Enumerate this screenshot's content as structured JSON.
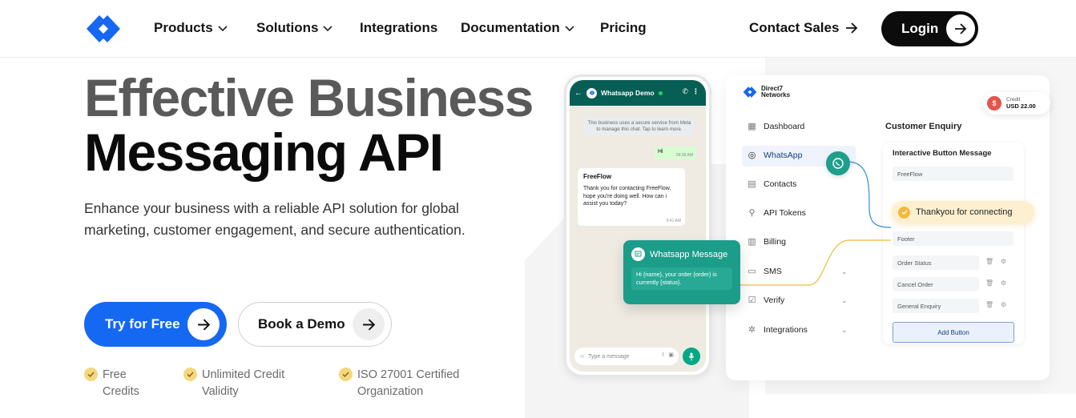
{
  "nav": {
    "products": "Products",
    "solutions": "Solutions",
    "integrations": "Integrations",
    "documentation": "Documentation",
    "pricing": "Pricing",
    "contact_sales": "Contact Sales",
    "login": "Login"
  },
  "hero": {
    "title_line1": "Effective Business",
    "title_line2": "Messaging API",
    "subtitle": "Enhance your business with a reliable API solution for global marketing, customer engagement, and secure authentication.",
    "cta_primary": "Try for Free",
    "cta_secondary": "Book a Demo",
    "features": [
      {
        "line1": "Free",
        "line2": "Credits"
      },
      {
        "line1": "Unlimited Credit",
        "line2": "Validity"
      },
      {
        "line1": "ISO 27001 Certified",
        "line2": "Organization"
      }
    ]
  },
  "phone": {
    "chat_title": "Whatsapp Demo",
    "notice": "This business uses a secure service from Meta to manage this chat. Tap to learn more.",
    "outgoing": "Hi",
    "outgoing_time": "09:38 AM",
    "incoming_name": "FreeFlow",
    "incoming_text": "Thank you for contacting FreeFlow, hope you're doing well. How can i assist you today?",
    "incoming_time": "9:41 AM",
    "input_placeholder": "Type a message"
  },
  "wa_card": {
    "title": "Whatsapp Message",
    "body": "Hi {name}, your order {order} is currently {status}."
  },
  "dashboard": {
    "brand": "Direct7 Networks",
    "brand_line1": "Direct7",
    "brand_line2": "Networks",
    "credit_label": "Credit",
    "credit_value": "USD 22.00",
    "menu": [
      {
        "label": "Dashboard",
        "icon": "grid-icon"
      },
      {
        "label": "WhatsApp",
        "icon": "whatsapp-icon"
      },
      {
        "label": "Contacts",
        "icon": "contacts-icon"
      },
      {
        "label": "API Tokens",
        "icon": "search-icon"
      },
      {
        "label": "Billing",
        "icon": "billing-icon"
      },
      {
        "label": "SMS",
        "icon": "sms-icon"
      },
      {
        "label": "Verify",
        "icon": "verify-icon"
      },
      {
        "label": "Integrations",
        "icon": "integrations-icon"
      }
    ],
    "section_title": "Customer Enquiry",
    "panel_title": "Interactive Button Message",
    "field_name": "FreeFlow",
    "toast": "Thankyou for connecting",
    "footer_label": "Footer",
    "buttons": [
      "Order Status",
      "Cancel Order",
      "General Enquiry"
    ],
    "add_button": "Add Button"
  },
  "colors": {
    "brand_blue": "#1568f2",
    "whatsapp_green": "#1c9d8a",
    "accent_yellow": "#f2b93b",
    "title_gray": "#5a5a5a"
  }
}
